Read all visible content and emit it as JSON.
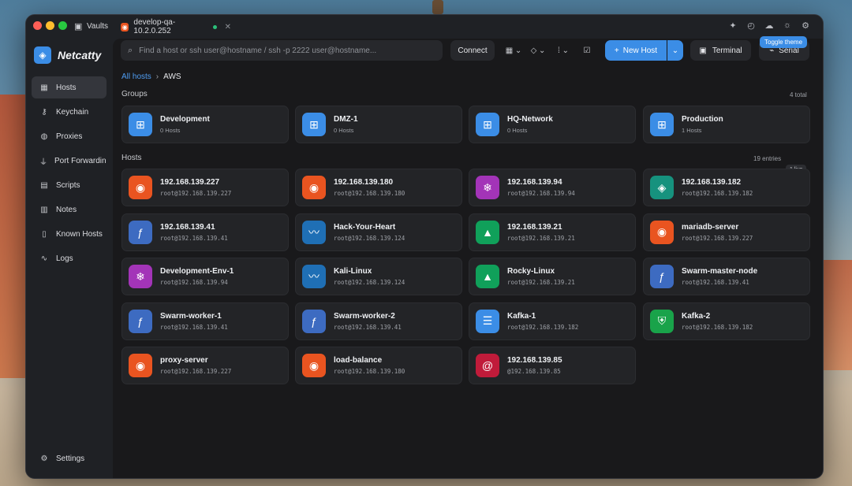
{
  "titlebar": {
    "vault_label": "Vaults",
    "tab_label": "develop-qa-10.2.0.252",
    "icons": [
      "sparkle-icon",
      "history-icon",
      "cloud-icon",
      "sun-icon",
      "gear-icon"
    ]
  },
  "sidebar": {
    "brand": "Netcatty",
    "items": [
      {
        "label": "Hosts",
        "icon": "grid-icon",
        "active": true
      },
      {
        "label": "Keychain",
        "icon": "key-icon"
      },
      {
        "label": "Proxies",
        "icon": "globe-icon"
      },
      {
        "label": "Port Forwarding",
        "icon": "plug-icon"
      },
      {
        "label": "Scripts",
        "icon": "file-icon"
      },
      {
        "label": "Notes",
        "icon": "note-icon"
      },
      {
        "label": "Known Hosts",
        "icon": "book-icon"
      },
      {
        "label": "Logs",
        "icon": "activity-icon"
      }
    ],
    "settings_label": "Settings"
  },
  "toolbar": {
    "search_placeholder": "Find a host or ssh user@hostname / ssh -p 2222 user@hostname...",
    "connect_label": "Connect",
    "new_host_label": "New Host",
    "terminal_label": "Terminal",
    "serial_label": "Serial",
    "tooltip": "Toggle theme"
  },
  "breadcrumb": {
    "root": "All hosts",
    "current": "AWS"
  },
  "groups": {
    "title": "Groups",
    "total": "4 total",
    "items": [
      {
        "name": "Development",
        "count": "0 Hosts"
      },
      {
        "name": "DMZ-1",
        "count": "0 Hosts"
      },
      {
        "name": "HQ-Network",
        "count": "0 Hosts"
      },
      {
        "name": "Production",
        "count": "1 Hosts"
      }
    ]
  },
  "hosts": {
    "title": "Hosts",
    "entries": "19 entries",
    "live": "1 live",
    "items": [
      {
        "name": "192.168.139.227",
        "addr": "root@192.168.139.227",
        "os": "ubuntu",
        "color": "#e95420"
      },
      {
        "name": "192.168.139.180",
        "addr": "root@192.168.139.180",
        "os": "ubuntu",
        "color": "#e95420"
      },
      {
        "name": "192.168.139.94",
        "addr": "root@192.168.139.94",
        "os": "nixos",
        "color": "#a334b8"
      },
      {
        "name": "192.168.139.182",
        "addr": "root@192.168.139.182",
        "os": "openeuler",
        "color": "#16927e"
      },
      {
        "name": "192.168.139.41",
        "addr": "root@192.168.139.41",
        "os": "fedora",
        "color": "#3d6bc1"
      },
      {
        "name": "Hack-Your-Heart",
        "addr": "root@192.168.139.124",
        "os": "kali",
        "color": "#1f6fb5"
      },
      {
        "name": "192.168.139.21",
        "addr": "root@192.168.139.21",
        "os": "rocky",
        "color": "#10a05a"
      },
      {
        "name": "mariadb-server",
        "addr": "root@192.168.139.227",
        "os": "ubuntu",
        "color": "#e95420"
      },
      {
        "name": "Development-Env-1",
        "addr": "root@192.168.139.94",
        "os": "nixos",
        "color": "#a334b8"
      },
      {
        "name": "Kali-Linux",
        "addr": "root@192.168.139.124",
        "os": "kali",
        "color": "#1f6fb5"
      },
      {
        "name": "Rocky-Linux",
        "addr": "root@192.168.139.21",
        "os": "rocky",
        "color": "#10a05a"
      },
      {
        "name": "Swarm-master-node",
        "addr": "root@192.168.139.41",
        "os": "fedora",
        "color": "#3d6bc1"
      },
      {
        "name": "Swarm-worker-1",
        "addr": "root@192.168.139.41",
        "os": "fedora",
        "color": "#3d6bc1"
      },
      {
        "name": "Swarm-worker-2",
        "addr": "root@192.168.139.41",
        "os": "fedora",
        "color": "#3d6bc1"
      },
      {
        "name": "Kafka-1",
        "addr": "root@192.168.139.182",
        "os": "server",
        "color": "#3b8de6"
      },
      {
        "name": "Kafka-2",
        "addr": "root@192.168.139.182",
        "os": "shield",
        "color": "#19a34a"
      },
      {
        "name": "proxy-server",
        "addr": "root@192.168.139.227",
        "os": "ubuntu",
        "color": "#e95420"
      },
      {
        "name": "load-balance",
        "addr": "root@192.168.139.180",
        "os": "ubuntu",
        "color": "#e95420"
      },
      {
        "name": "192.168.139.85",
        "addr": "@192.168.139.85",
        "os": "debian",
        "color": "#c01b3a"
      }
    ]
  },
  "colors": {
    "accent": "#3b8de6",
    "background": "#19191b",
    "card": "#232427"
  }
}
